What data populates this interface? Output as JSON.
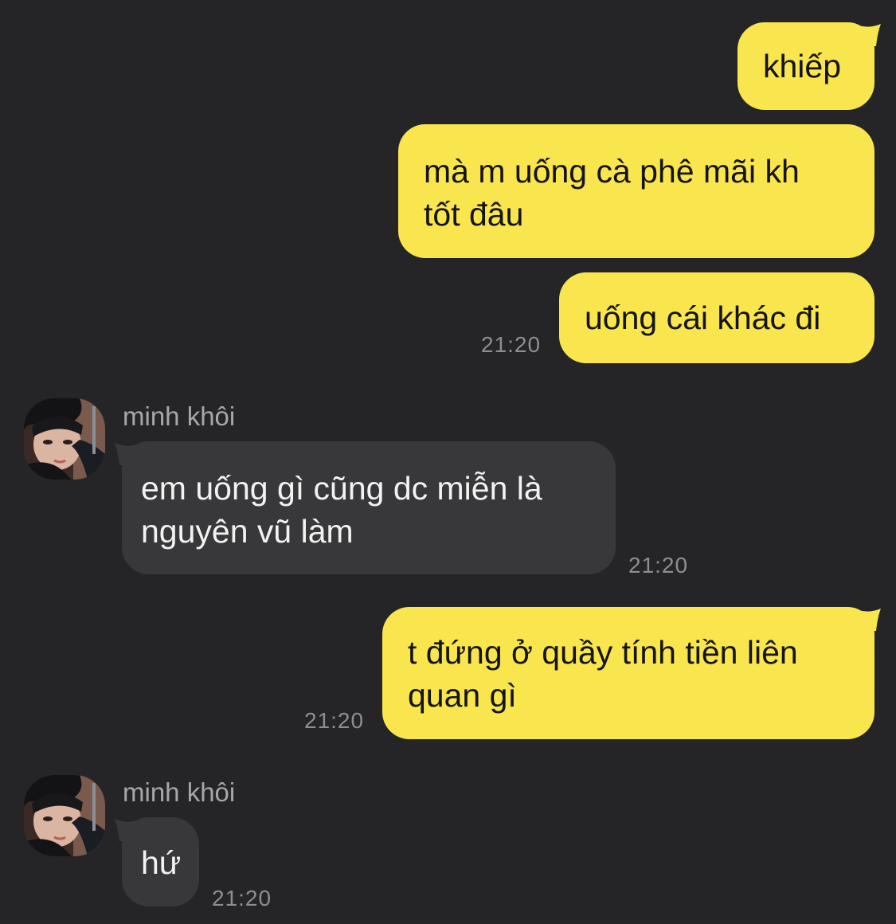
{
  "messages": [
    {
      "direction": "out",
      "text": "khiếp"
    },
    {
      "direction": "out",
      "text": "mà m uống cà phê mãi kh\ntốt đâu"
    },
    {
      "direction": "out",
      "text": "uống cái khác đi",
      "time": "21:20"
    },
    {
      "direction": "in",
      "sender": "minh khôi",
      "text": "em uống gì cũng dc miễn là\nnguyên vũ làm",
      "time": "21:20"
    },
    {
      "direction": "out",
      "text": "t đứng ở quầy tính tiền liên\nquan gì",
      "time": "21:20"
    },
    {
      "direction": "in",
      "sender": "minh khôi",
      "text": "hứ",
      "time": "21:20"
    }
  ],
  "colors": {
    "background": "#252527",
    "outgoing_bubble": "#f9e54e",
    "incoming_bubble": "#38383a",
    "timestamp": "#8e8e92",
    "sender_name": "#a7a7ab"
  },
  "icons": {
    "avatar": "contact-avatar-photo"
  }
}
